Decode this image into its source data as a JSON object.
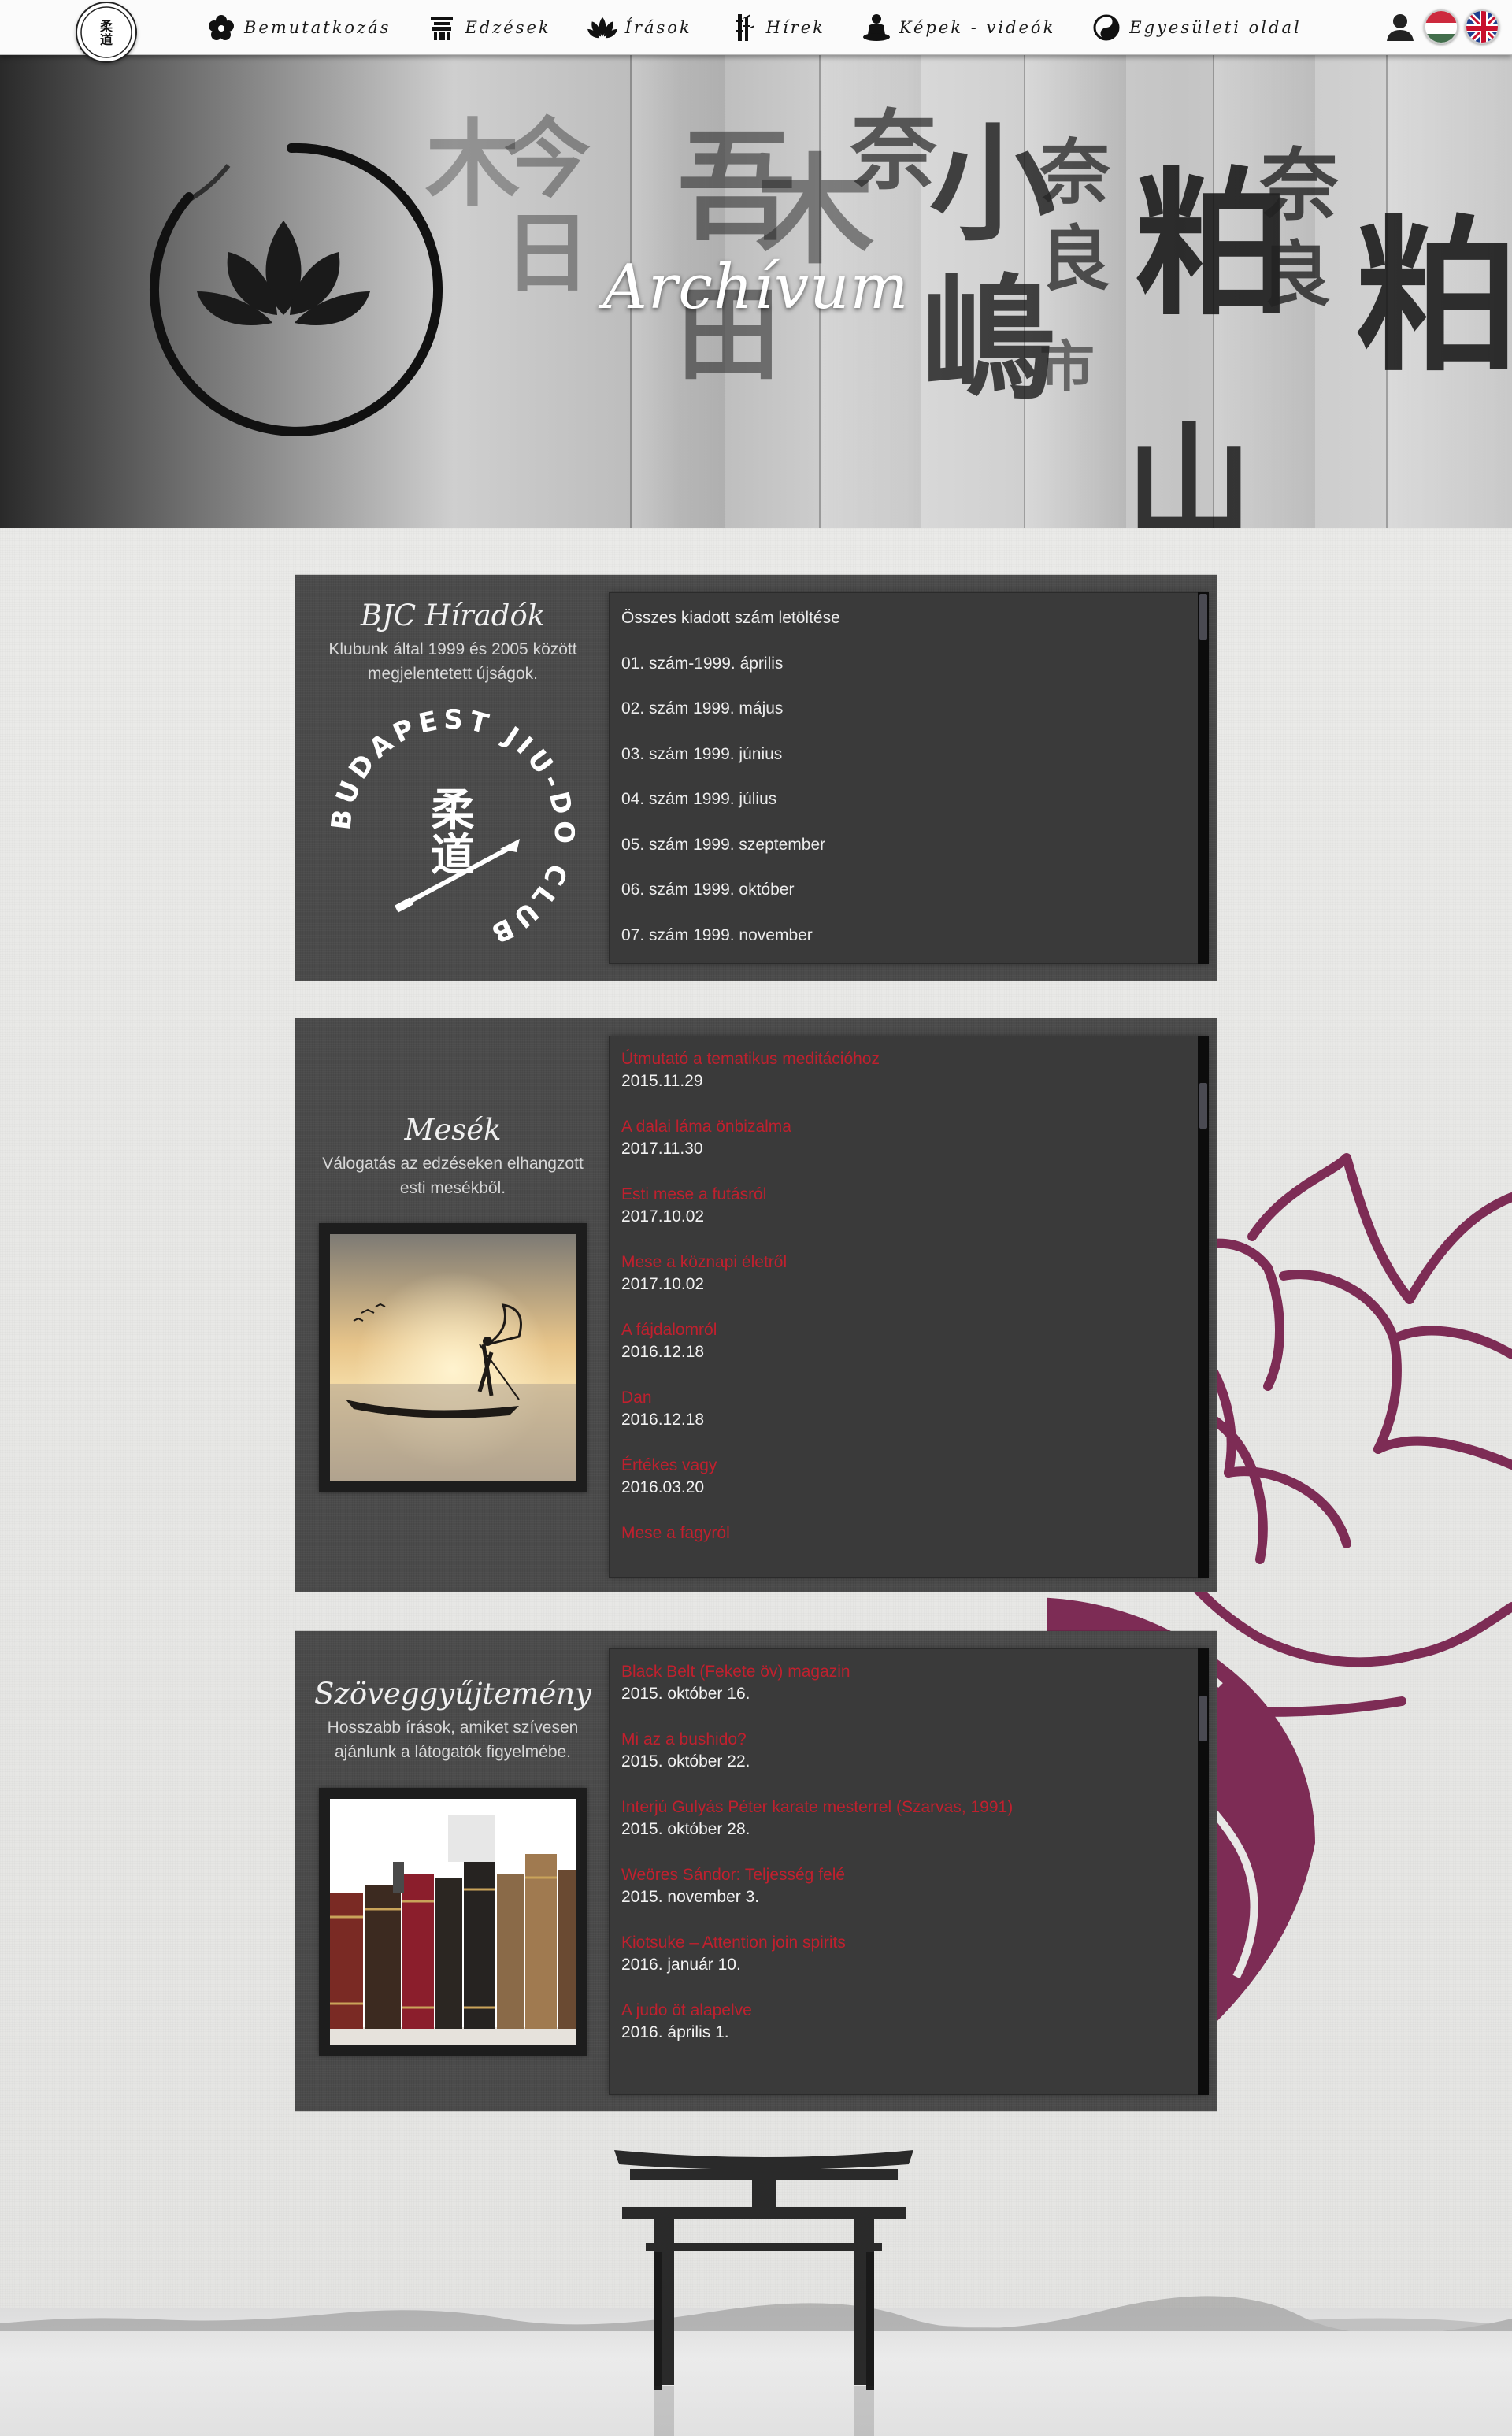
{
  "nav": {
    "items": [
      {
        "label": "Bemutatkozás",
        "icon": "flower-icon"
      },
      {
        "label": "Edzések",
        "icon": "shrine-icon"
      },
      {
        "label": "Írások",
        "icon": "lotus-icon"
      },
      {
        "label": "Hírek",
        "icon": "bamboo-icon"
      },
      {
        "label": "Képek - videók",
        "icon": "buddha-icon"
      },
      {
        "label": "Egyesületi oldal",
        "icon": "yin-yang-icon"
      }
    ]
  },
  "hero": {
    "title": "Archívum"
  },
  "panel1": {
    "title": "BJC Híradók",
    "desc_line1": "Klubunk által 1999 és 2005 között",
    "desc_line2": "megjelentetett újságok.",
    "logo_text": "BUDAPEST JIU-DO CLUB",
    "items": [
      "Összes kiadott szám letöltése",
      "01. szám-1999. április",
      "02. szám 1999. május",
      "03. szám 1999. június",
      "04. szám 1999. július",
      "05. szám 1999. szeptember",
      "06. szám 1999. október",
      "07. szám 1999. november"
    ]
  },
  "panel2": {
    "title": "Mesék",
    "desc_line1": "Válogatás az edzéseken elhangzott",
    "desc_line2": "esti mesékből.",
    "entries": [
      {
        "title": "Útmutató a tematikus meditációhoz",
        "date": "2015.11.29"
      },
      {
        "title": "A dalai láma önbizalma",
        "date": "2017.11.30"
      },
      {
        "title": "Esti mese a futásról",
        "date": "2017.10.02"
      },
      {
        "title": "Mese a köznapi életről",
        "date": "2017.10.02"
      },
      {
        "title": "A fájdalomról",
        "date": "2016.12.18"
      },
      {
        "title": "Dan",
        "date": "2016.12.18"
      },
      {
        "title": "Értékes vagy",
        "date": "2016.03.20"
      },
      {
        "title": "Mese a fagyról",
        "date": ""
      }
    ]
  },
  "panel3": {
    "title": "Szöveggyűjtemény",
    "desc_line1": "Hosszabb írások, amiket szívesen",
    "desc_line2": "ajánlunk a látogatók figyelmébe.",
    "entries": [
      {
        "title": "Black Belt (Fekete öv) magazin",
        "date": "2015. október 16."
      },
      {
        "title": "Mi az a bushido?",
        "date": "2015. október 22."
      },
      {
        "title": "Interjú Gulyás Péter karate mesterrel (Szarvas, 1991)",
        "date": "2015. október 28."
      },
      {
        "title": "Weöres Sándor: Teljesség felé",
        "date": "2015. november 3."
      },
      {
        "title": "Kiotsuke – Attention join spirits",
        "date": "2016. január 10."
      },
      {
        "title": "A judo öt alapelve",
        "date": "2016. április 1."
      }
    ]
  },
  "colors": {
    "accent_red": "#c0202e",
    "lotus_purple": "#7d2c55",
    "panel_bg": "#4b4b4b"
  }
}
